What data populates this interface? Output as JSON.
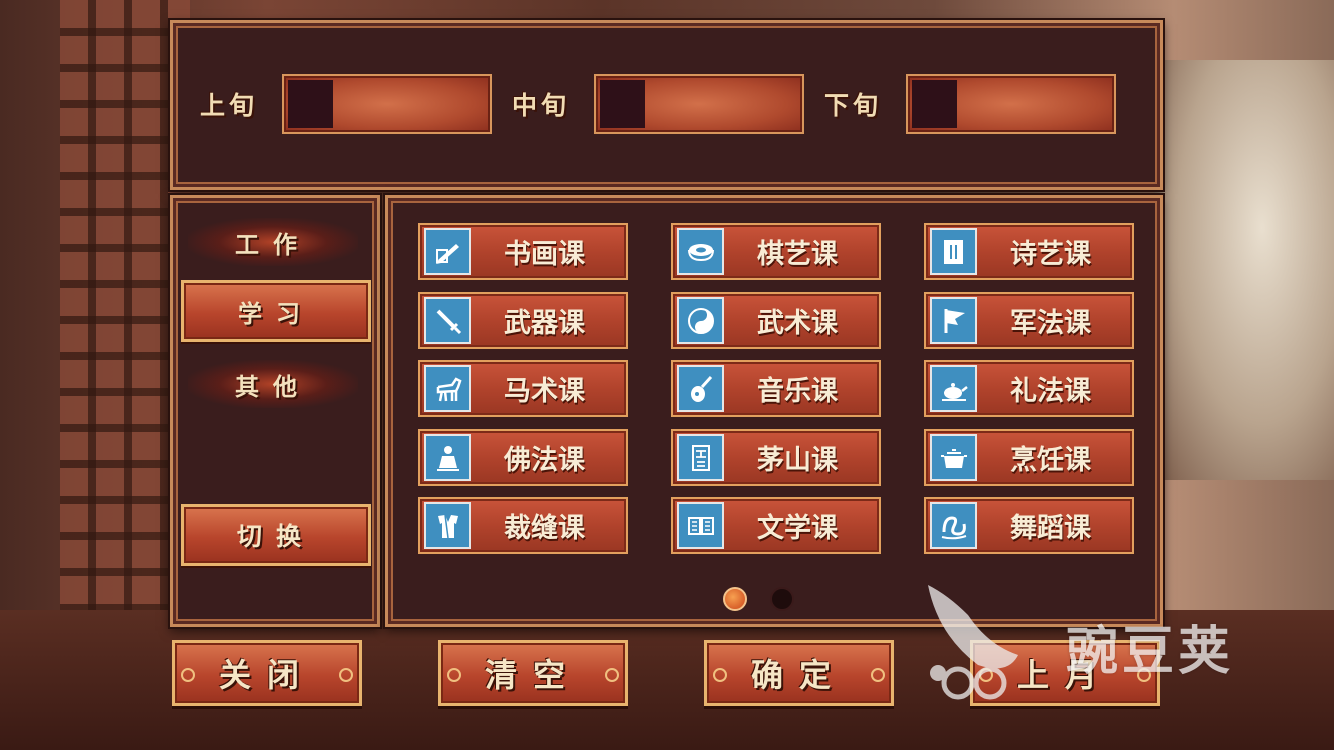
{
  "top": {
    "xun": [
      {
        "label": "上旬"
      },
      {
        "label": "中旬"
      },
      {
        "label": "下旬"
      }
    ]
  },
  "sidebar": {
    "tabs": [
      {
        "label": "工作"
      },
      {
        "label": "学习"
      },
      {
        "label": "其他"
      }
    ],
    "switch_label": "切换"
  },
  "courses": [
    {
      "label": "书画课",
      "icon": "brush-scroll-icon"
    },
    {
      "label": "棋艺课",
      "icon": "go-bowl-icon"
    },
    {
      "label": "诗艺课",
      "icon": "poetry-scroll-icon"
    },
    {
      "label": "武器课",
      "icon": "sword-icon"
    },
    {
      "label": "武术课",
      "icon": "yin-yang-icon"
    },
    {
      "label": "军法课",
      "icon": "flag-icon"
    },
    {
      "label": "马术课",
      "icon": "horse-icon"
    },
    {
      "label": "音乐课",
      "icon": "pipa-icon"
    },
    {
      "label": "礼法课",
      "icon": "teapot-icon"
    },
    {
      "label": "佛法课",
      "icon": "buddha-icon"
    },
    {
      "label": "茅山课",
      "icon": "talisman-icon"
    },
    {
      "label": "烹饪课",
      "icon": "cooking-pot-icon"
    },
    {
      "label": "裁缝课",
      "icon": "robe-icon"
    },
    {
      "label": "文学课",
      "icon": "book-icon"
    },
    {
      "label": "舞蹈课",
      "icon": "ribbon-dance-icon"
    }
  ],
  "pagination": {
    "current": 1,
    "total": 2
  },
  "buttons": {
    "close": "关闭",
    "clear": "清空",
    "confirm": "确定",
    "previous": "上月"
  },
  "watermark": {
    "text": "豌豆荚"
  }
}
